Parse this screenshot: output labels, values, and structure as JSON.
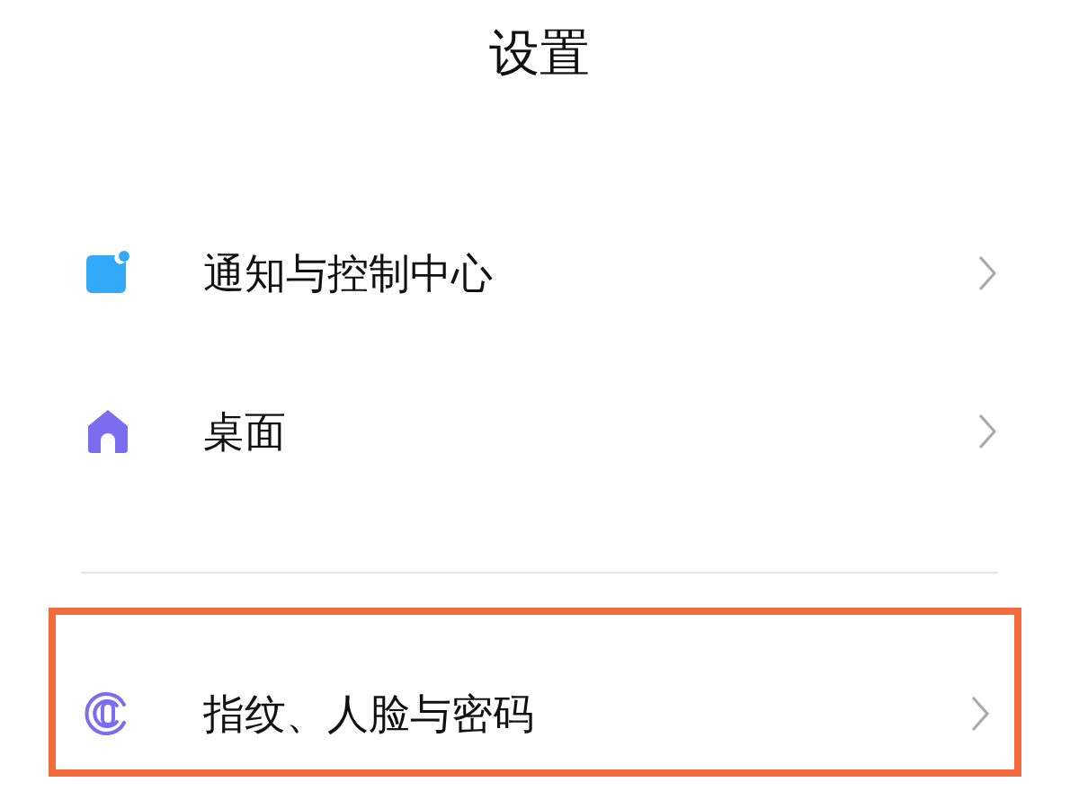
{
  "title": "设置",
  "groups": [
    [
      {
        "kind": "notification",
        "label": "通知与控制中心",
        "highlighted": false
      },
      {
        "kind": "home",
        "label": "桌面",
        "highlighted": false
      }
    ],
    [
      {
        "kind": "fingerprint",
        "label": "指纹、人脸与密码",
        "highlighted": true
      }
    ]
  ]
}
